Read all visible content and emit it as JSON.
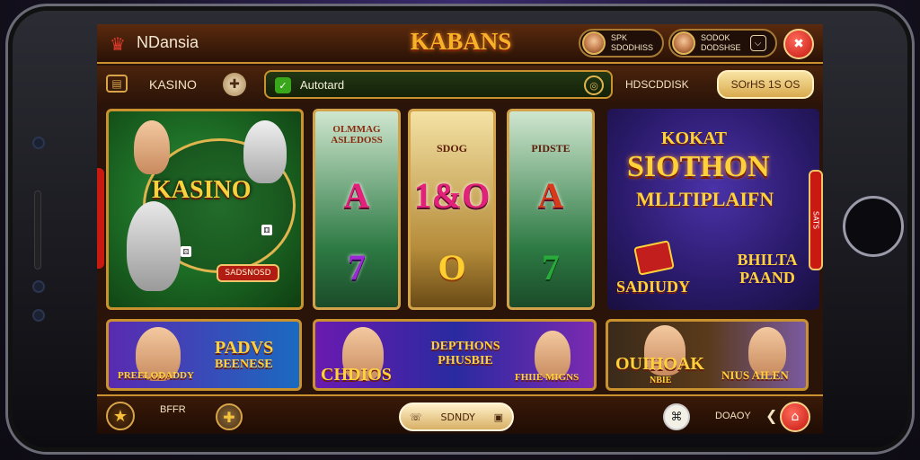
{
  "header": {
    "brand": "NDansia",
    "title": "KABANS",
    "user1": {
      "line1": "SPK",
      "line2": "SDODHISS"
    },
    "user2": {
      "line1": "SODOK",
      "line2": "DODSHSE"
    }
  },
  "nav": {
    "label": "KASINO",
    "search_value": "Autotard",
    "text": "HDSCDDISK",
    "pill": "SOrHS 1S OS"
  },
  "tiles": {
    "kasino": {
      "title": "KASINO",
      "button": "SADSNOSD"
    },
    "reel1": {
      "top": "OLMMAG ASLEDOSS",
      "symbol_top": "A",
      "symbol_bot": "7"
    },
    "reel2": {
      "label": "SDOG",
      "symbol_top": "1&O",
      "symbol_bot": "O"
    },
    "reel3": {
      "label": "PIDSTE",
      "symbol_top": "A",
      "symbol_bot": "7"
    },
    "promo": {
      "top": "KOKAT",
      "main": "SIOTHON",
      "sub": "MLLTIPLAIFN",
      "badge1": "SADIUDY",
      "badge2": "BHILTA PAAND",
      "side": "SATS"
    }
  },
  "bottom": {
    "b1": {
      "t1": "PADVS",
      "t2": "BEENESE",
      "t3": "PREELODADDY"
    },
    "b2": {
      "t1": "CHDIOS",
      "t2": "DEPTHONS PHUSBIE",
      "t3": "FHIIE MIGNS"
    },
    "b3": {
      "t1": "OUIHOAK",
      "t2": "NBIE",
      "t3": "NIUS AILEN"
    }
  },
  "footer": {
    "text": "BFFR",
    "spin_label": "SDNDY",
    "text2": "DOAOY"
  },
  "colors": {
    "gold": "#c9922e",
    "red": "#c4170f",
    "green": "#2aaa3a"
  },
  "icons": [
    "star-icon",
    "plus-icon",
    "chevron-left-icon",
    "close-icon",
    "settings-icon",
    "search-icon"
  ]
}
